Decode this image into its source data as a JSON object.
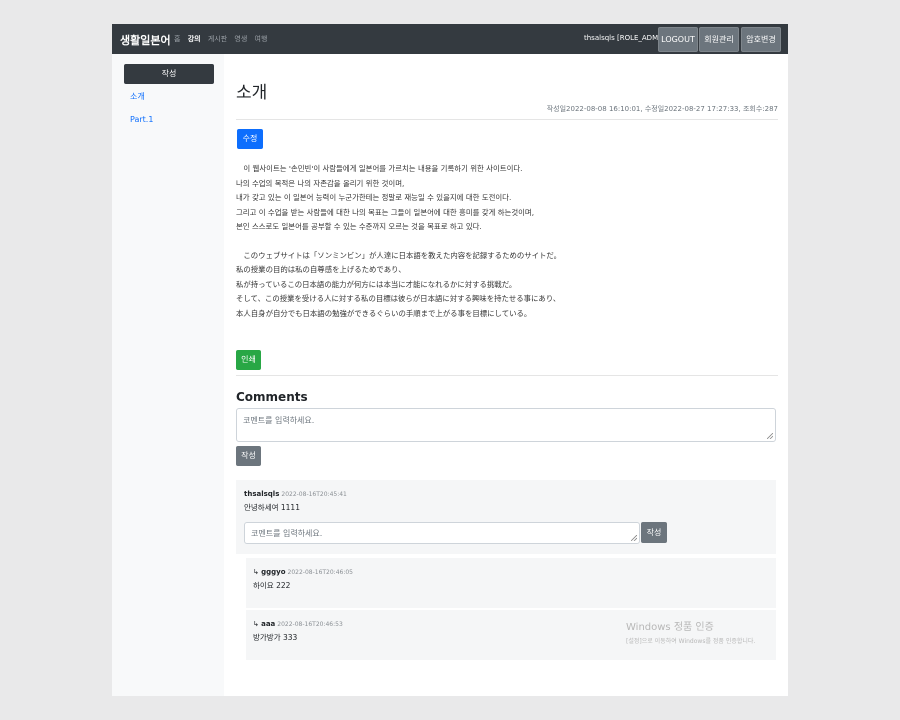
{
  "navbar": {
    "brand": "생활일본어",
    "links": [
      "홈",
      "강의",
      "게시판",
      "영생",
      "여행"
    ],
    "active_index": 1,
    "user": "thsalsqls [ROLE_ADMIN]",
    "buttons": {
      "logout": "LOGOUT",
      "members": "회원관리",
      "password": "암호변경"
    }
  },
  "sidebar": {
    "write_label": "작성",
    "items": [
      "소개",
      "Part.1"
    ]
  },
  "post": {
    "title": "소개",
    "meta": "작성일2022-08-08 16:10:01, 수정일2022-08-27 17:27:33, 조회수:287",
    "edit_label": "수정",
    "print_label": "인쇄",
    "lines_ko": [
      "　이 웹사이트는 '손민빈'이 사람들에게 일본어를 가르치는 내용을 기록하기 위한 사이트이다.",
      "나의 수업의 목적은 나의 자존감을 올리기 위한 것이며,",
      "내가 갖고 있는 이 일본어 능력이 누군가한테는 정말로 재능일 수 있을지에 대한 도전이다.",
      "그리고 이 수업을 받는 사람들에 대한 나의 목표는 그들이 일본어에 대한 흥미를 갖게 하는것이며,",
      "본인 스스로도 일본어를 공부할 수 있는 수준까지 오르는 것을 목표로 하고 있다."
    ],
    "lines_ja": [
      "　このウェブサイトは「ソンミンビン」が人達に日本語を教えた内容を記録するためのサイトだ。",
      "私の授業の目的は私の自尊感を上げるためであり、",
      "私が持っているこの日本語の能力が何方には本当に才能になれるかに対する挑戦だ。",
      "そして、この授業を受ける人に対する私の目標は彼らが日本語に対する興味を持たせる事にあり、",
      "本人自身が自分でも日本語の勉強ができるぐらいの手順まで上がる事を目標にしている。"
    ]
  },
  "comments": {
    "heading": "Comments",
    "placeholder": "코멘트를 입력하세요.",
    "submit_label": "작성",
    "items": [
      {
        "author": "thsalsqls",
        "date": "2022-08-16T20:45:41",
        "text": "안녕하세여 1111",
        "reply_placeholder": "코멘트를 입력하세요.",
        "reply_submit": "작성"
      }
    ],
    "replies": [
      {
        "prefix": "↳",
        "author": "gggyo",
        "date": "2022-08-16T20:46:05",
        "text": "하이요 222"
      },
      {
        "prefix": "↳",
        "author": "aaa",
        "date": "2022-08-16T20:46:53",
        "text": "방가방가 333"
      }
    ]
  },
  "watermark": {
    "title": "Windows 정품 인증",
    "subtitle": "[설정]으로 이동하여 Windows를 정품 인증합니다."
  }
}
